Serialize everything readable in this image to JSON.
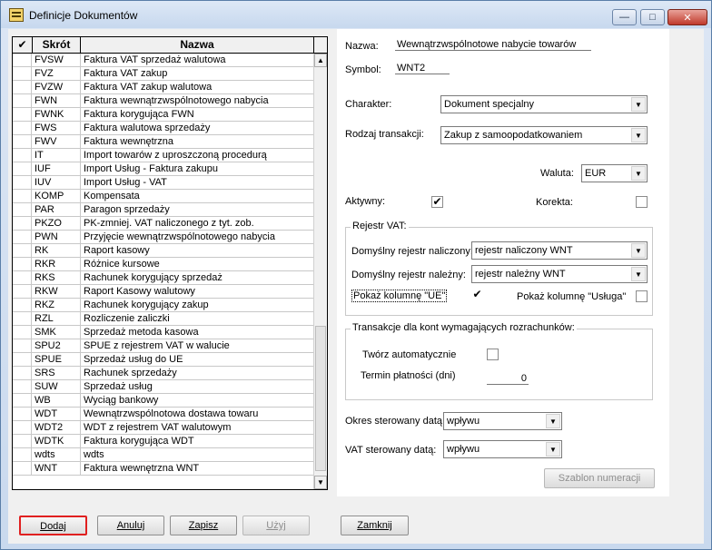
{
  "window": {
    "title": "Definicje Dokumentów",
    "buttons": {
      "minimize": "—",
      "maximize": "□",
      "close": "✕"
    }
  },
  "grid": {
    "headers": {
      "check": "✔",
      "code": "Skrót",
      "name": "Nazwa"
    },
    "rows": [
      {
        "code": "FVSW",
        "name": "Faktura VAT sprzedaż walutowa"
      },
      {
        "code": "FVZ",
        "name": "Faktura VAT zakup"
      },
      {
        "code": "FVZW",
        "name": "Faktura VAT zakup walutowa"
      },
      {
        "code": "FWN",
        "name": "Faktura wewnątrzwspólnotowego nabycia"
      },
      {
        "code": "FWNK",
        "name": "Faktura korygująca FWN"
      },
      {
        "code": "FWS",
        "name": "Faktura walutowa sprzedaży"
      },
      {
        "code": "FWV",
        "name": "Faktura wewnętrzna"
      },
      {
        "code": "IT",
        "name": "Import towarów z uproszczoną procedurą"
      },
      {
        "code": "IUF",
        "name": "Import Usług - Faktura zakupu"
      },
      {
        "code": "IUV",
        "name": "Import Usług - VAT"
      },
      {
        "code": "KOMP",
        "name": "Kompensata"
      },
      {
        "code": "PAR",
        "name": "Paragon sprzedaży"
      },
      {
        "code": "PKZO",
        "name": "PK-zmniej. VAT naliczonego z tyt. zob."
      },
      {
        "code": "PWN",
        "name": "Przyjęcie wewnątrzwspólnotowego nabycia"
      },
      {
        "code": "RK",
        "name": "Raport kasowy"
      },
      {
        "code": "RKR",
        "name": "Różnice kursowe"
      },
      {
        "code": "RKS",
        "name": "Rachunek korygujący sprzedaż"
      },
      {
        "code": "RKW",
        "name": "Raport Kasowy walutowy"
      },
      {
        "code": "RKZ",
        "name": "Rachunek korygujący zakup"
      },
      {
        "code": "RZL",
        "name": "Rozliczenie zaliczki"
      },
      {
        "code": "SMK",
        "name": "Sprzedaż metoda kasowa"
      },
      {
        "code": "SPU2",
        "name": "SPUE z rejestrem VAT w walucie"
      },
      {
        "code": "SPUE",
        "name": "Sprzedaż usług do UE"
      },
      {
        "code": "SRS",
        "name": "Rachunek sprzedaży"
      },
      {
        "code": "SUW",
        "name": "Sprzedaż usług"
      },
      {
        "code": "WB",
        "name": "Wyciąg bankowy"
      },
      {
        "code": "WDT",
        "name": "Wewnątrzwspólnotowa dostawa towaru"
      },
      {
        "code": "WDT2",
        "name": "WDT z rejestrem VAT walutowym"
      },
      {
        "code": "WDTK",
        "name": "Faktura korygująca WDT"
      },
      {
        "code": "wdts",
        "name": "wdts"
      },
      {
        "code": "WNT",
        "name": "Faktura wewnętrzna WNT"
      }
    ],
    "scroll_up": "▲",
    "scroll_down": "▼"
  },
  "form": {
    "nazwa_label": "Nazwa:",
    "nazwa_value": "Wewnątrzwspólnotowe nabycie towarów",
    "symbol_label": "Symbol:",
    "symbol_value": "WNT2",
    "charakter_label": "Charakter:",
    "charakter_value": "Dokument specjalny",
    "rodzaj_label": "Rodzaj transakcji:",
    "rodzaj_value": "Zakup z samoopodatkowaniem",
    "waluta_label": "Waluta:",
    "waluta_value": "EUR",
    "aktywny_label": "Aktywny:",
    "aktywny_checked": "✔",
    "korekta_label": "Korekta:",
    "rejestr_group": "Rejestr VAT:",
    "rej_naliczony_label": "Domyślny rejestr naliczony:",
    "rej_naliczony_value": "rejestr naliczony WNT",
    "rej_nalezny_label": "Domyślny rejestr należny:",
    "rej_nalezny_value": "rejestr należny WNT",
    "pokaz_ue_label": "Pokaż kolumnę \"UE\"",
    "pokaz_ue_checked": "✔",
    "pokaz_usluga_label": "Pokaż kolumnę \"Usługa\"",
    "transakcje_group": "Transakcje dla kont wymagających rozrachunków:",
    "tworz_label": "Twórz automatycznie",
    "termin_label": "Termin płatności (dni)",
    "termin_value": "0",
    "okres_label": "Okres sterowany datą:",
    "okres_value": "wpływu",
    "vat_label": "VAT sterowany datą:",
    "vat_value": "wpływu",
    "szablon_button": "Szablon numeracji"
  },
  "footer": {
    "dodaj": "Dodaj",
    "anuluj": "Anuluj",
    "zapisz": "Zapisz",
    "uzyj": "Użyj",
    "zamknij": "Zamknij"
  }
}
